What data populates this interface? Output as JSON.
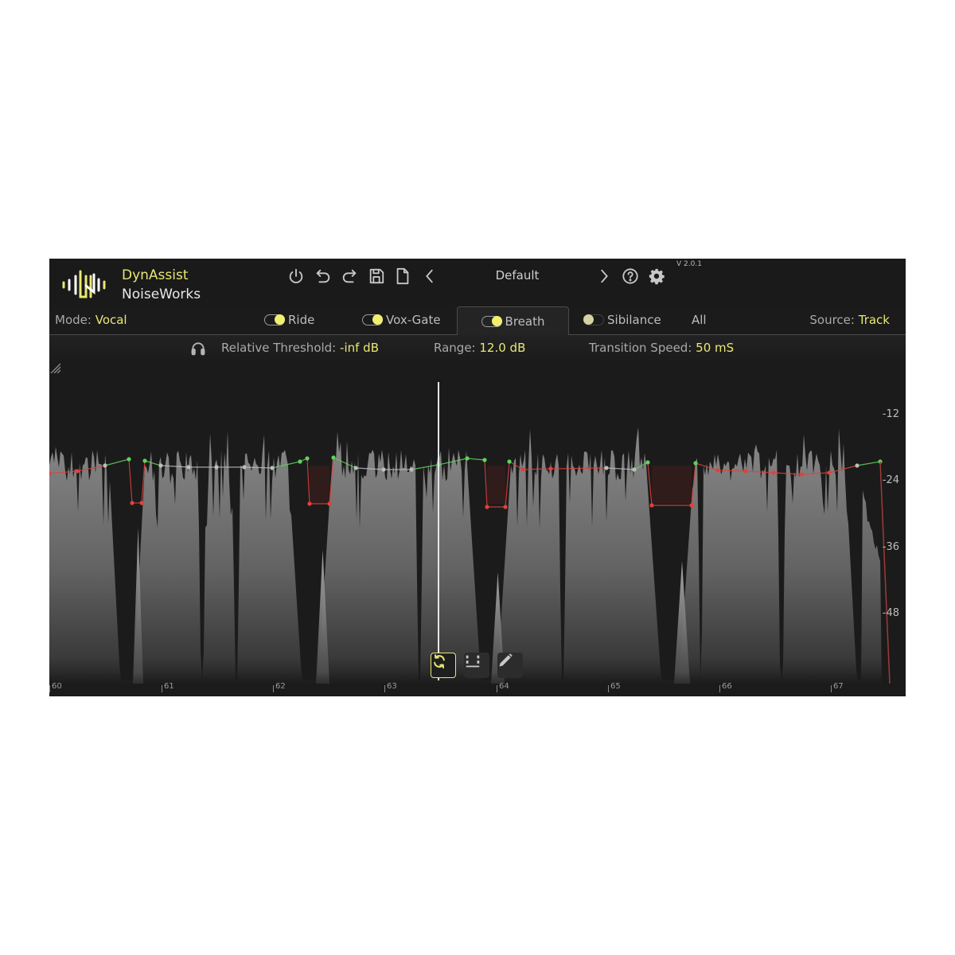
{
  "app": {
    "brand_line1": "DynAssist",
    "brand_line2": "NoiseWorks",
    "version": "V 2.0.1"
  },
  "toolbar": {
    "icons": [
      "power-icon",
      "undo-icon",
      "redo-icon",
      "save-icon",
      "new-file-icon",
      "prev-preset-icon",
      "next-preset-icon",
      "help-icon",
      "settings-icon"
    ],
    "preset_name": "Default"
  },
  "mode": {
    "label": "Mode:",
    "value": "Vocal"
  },
  "tabs": [
    {
      "label": "Ride",
      "toggle": "on",
      "active": false
    },
    {
      "label": "Vox-Gate",
      "toggle": "on",
      "active": false
    },
    {
      "label": "Breath",
      "toggle": "on",
      "active": true
    },
    {
      "label": "Sibilance",
      "toggle": "off",
      "active": false
    },
    {
      "label": "All",
      "toggle": null,
      "active": false
    }
  ],
  "source": {
    "label": "Source:",
    "value": "Track"
  },
  "params": {
    "listen_icon": "headphones-icon",
    "relative_threshold": {
      "label": "Relative Threshold:",
      "value": "-inf dB"
    },
    "range": {
      "label": "Range:",
      "value": "12.0 dB"
    },
    "transition_speed": {
      "label": "Transition Speed:",
      "value": "50 mS"
    }
  },
  "graph": {
    "db_labels": [
      "-12",
      "-24",
      "-36",
      "-48"
    ],
    "time_labels": [
      "60",
      "61",
      "62",
      "63",
      "64",
      "65",
      "66",
      "67"
    ],
    "playhead_time": 63.45,
    "colors": {
      "boost": "#5fd35f",
      "neutral": "#bdbdbd",
      "cut": "#e0413d",
      "accent": "#e9e773"
    }
  },
  "tools": [
    {
      "name": "auto-loop-tool",
      "icon": "refresh-icon",
      "selected": true
    },
    {
      "name": "range-select-tool",
      "icon": "bracket-select-icon",
      "selected": false
    },
    {
      "name": "draw-tool",
      "icon": "pencil-icon",
      "selected": false
    }
  ]
}
